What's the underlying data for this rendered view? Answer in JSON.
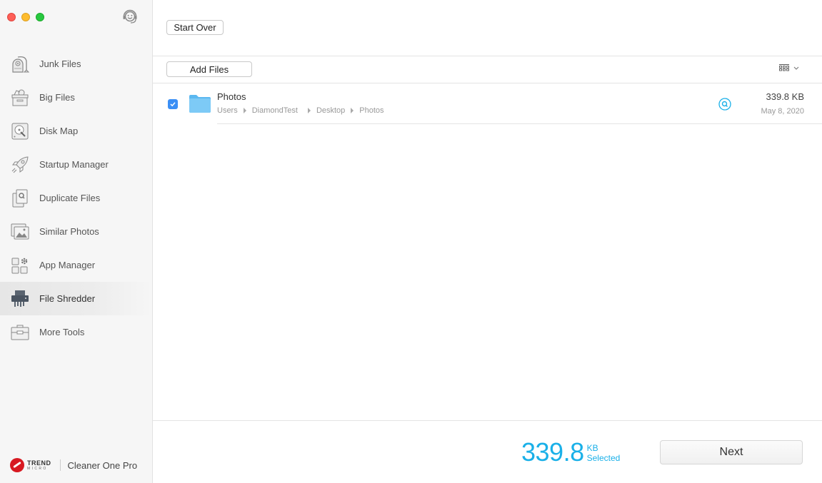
{
  "window": {
    "controls": [
      "close",
      "minimize",
      "zoom"
    ],
    "support_icon": "support-headset-icon"
  },
  "sidebar": {
    "items": [
      {
        "label": "Junk Files",
        "icon": "vacuum-icon",
        "active": false
      },
      {
        "label": "Big Files",
        "icon": "box-icon",
        "active": false
      },
      {
        "label": "Disk Map",
        "icon": "disk-icon",
        "active": false
      },
      {
        "label": "Startup Manager",
        "icon": "rocket-icon",
        "active": false
      },
      {
        "label": "Duplicate Files",
        "icon": "duplicate-icon",
        "active": false
      },
      {
        "label": "Similar Photos",
        "icon": "photos-icon",
        "active": false
      },
      {
        "label": "App Manager",
        "icon": "apps-gear-icon",
        "active": false
      },
      {
        "label": "File Shredder",
        "icon": "shredder-icon",
        "active": true
      },
      {
        "label": "More Tools",
        "icon": "toolbox-icon",
        "active": false
      }
    ],
    "brand": {
      "company_line1": "TREND",
      "company_line2": "MICRO",
      "product": "Cleaner One Pro"
    }
  },
  "toolbar": {
    "start_over_label": "Start Over",
    "add_files_label": "Add Files",
    "view_toggle_icon": "grid-view-icon"
  },
  "files": [
    {
      "name": "Photos",
      "checked": true,
      "path": [
        "Users",
        "DiamondTest",
        "Desktop",
        "Photos"
      ],
      "size": "339.8 KB",
      "date": "May 8, 2020"
    }
  ],
  "footer": {
    "total_value": "339.8",
    "total_unit": "KB",
    "total_label": "Selected",
    "next_label": "Next"
  },
  "colors": {
    "accent": "#1ab0e8",
    "checkbox": "#3b8ff5",
    "folder": "#6cc4f4"
  }
}
